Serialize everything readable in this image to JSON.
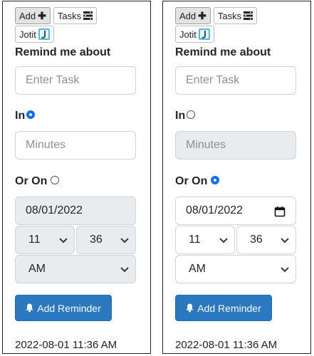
{
  "panels": [
    {
      "add_label": "Add",
      "tasks_label": "Tasks",
      "jotit_label": "Jotit",
      "heading": "Remind me about",
      "task_placeholder": "Enter Task",
      "in_label": "In",
      "in_selected": true,
      "minutes_placeholder": "Minutes",
      "or_on_label": "Or On",
      "on_selected": false,
      "date_value": "08/01/2022",
      "hour_value": "11",
      "minute_value": "36",
      "ampm_value": "AM",
      "add_reminder_label": "Add Reminder",
      "timestamp": "2022-08-01 11:36 AM"
    },
    {
      "add_label": "Add",
      "tasks_label": "Tasks",
      "jotit_label": "Jotit",
      "heading": "Remind me about",
      "task_placeholder": "Enter Task",
      "in_label": "In",
      "in_selected": false,
      "minutes_placeholder": "Minutes",
      "or_on_label": "Or On",
      "on_selected": true,
      "date_value": "08/01/2022",
      "hour_value": "11",
      "minute_value": "36",
      "ampm_value": "AM",
      "add_reminder_label": "Add Reminder",
      "timestamp": "2022-08-01 11:36 AM"
    }
  ],
  "colors": {
    "primary_button": "#2a78c0",
    "radio_checked": "#0d6efd",
    "disabled_field": "#e9ecef"
  },
  "icons": {
    "add": "plus-icon",
    "tasks": "list-icon",
    "jotit": "jotit-logo-icon",
    "bell": "bell-icon",
    "calendar": "calendar-icon",
    "chevron": "chevron-down-icon"
  }
}
